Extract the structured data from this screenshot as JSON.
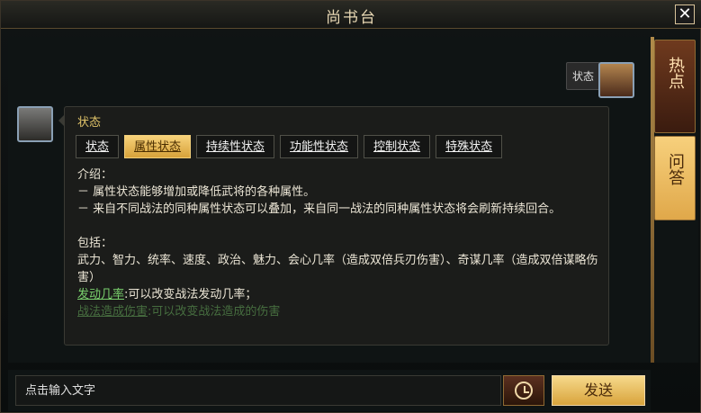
{
  "window": {
    "title": "尚书台"
  },
  "player_message": {
    "text": "状态"
  },
  "npc_message": {
    "title": "状态",
    "tabs": [
      {
        "label": "状态",
        "active": false
      },
      {
        "label": "属性状态",
        "active": true
      },
      {
        "label": "持续性状态",
        "active": false
      },
      {
        "label": "功能性状态",
        "active": false
      },
      {
        "label": "控制状态",
        "active": false
      },
      {
        "label": "特殊状态",
        "active": false
      }
    ],
    "content": {
      "intro_heading": "介绍：",
      "intro_line1": "－ 属性状态能够增加或降低武将的各种属性。",
      "intro_line2": "－ 来自不同战法的同种属性状态可以叠加，来自同一战法的同种属性状态将会刷新持续回合。",
      "include_heading": "包括：",
      "include_text": "武力、智力、统率、速度、政治、魅力、会心几率（造成双倍兵刃伤害）、奇谋几率（造成双倍谋略伤害）",
      "link1": "发动几率",
      "link1_desc": ":可以改变战法发动几率；",
      "link2_partial": "战法造成伤害",
      "link2_desc": ":可以改变战法造成的伤害"
    }
  },
  "sidebar": {
    "hot_label": "热点",
    "qa_label": "问答"
  },
  "input": {
    "placeholder": "点击输入文字",
    "send_label": "发送"
  }
}
